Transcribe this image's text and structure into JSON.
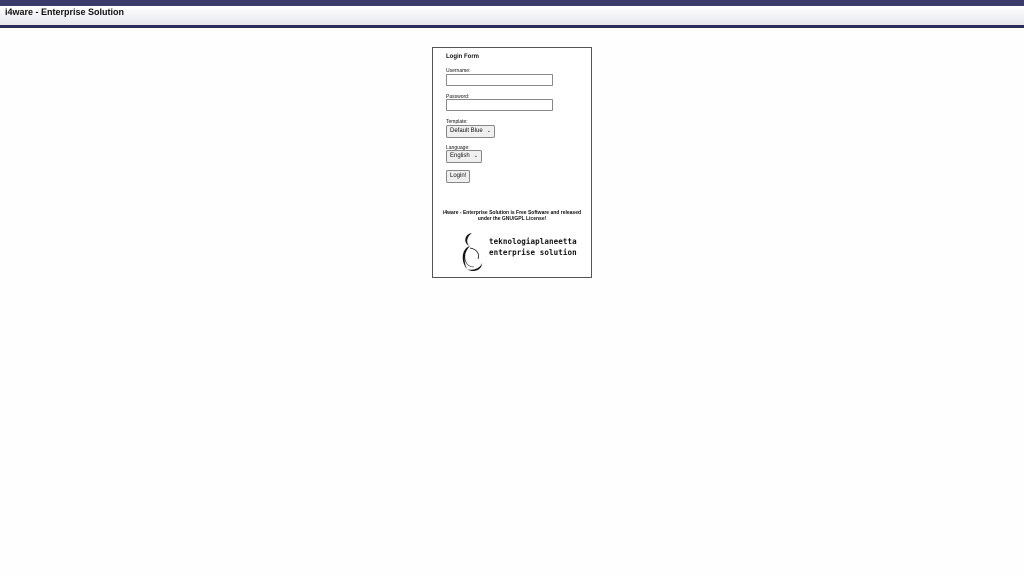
{
  "header": {
    "title": "i4ware - Enterprise Solution"
  },
  "login_form": {
    "title": "Login Form",
    "username_label": "Username:",
    "username_value": "",
    "password_label": "Password:",
    "password_value": "",
    "template_label": "Template:",
    "template_selected": "Default Blue",
    "language_label": "Language:",
    "language_selected": "English",
    "login_button": "Login!",
    "license_text": "i4ware - Enterprise Solution is Free Software and released under the GNU/GPL License!"
  },
  "logo": {
    "line1": "teknologiaplaneetta",
    "line2": "enterprise solution",
    "icon": "crescent-swirl-logo"
  },
  "colors": {
    "header_stripe": "#3b3b6b",
    "header_border": "#2e2e5a"
  }
}
